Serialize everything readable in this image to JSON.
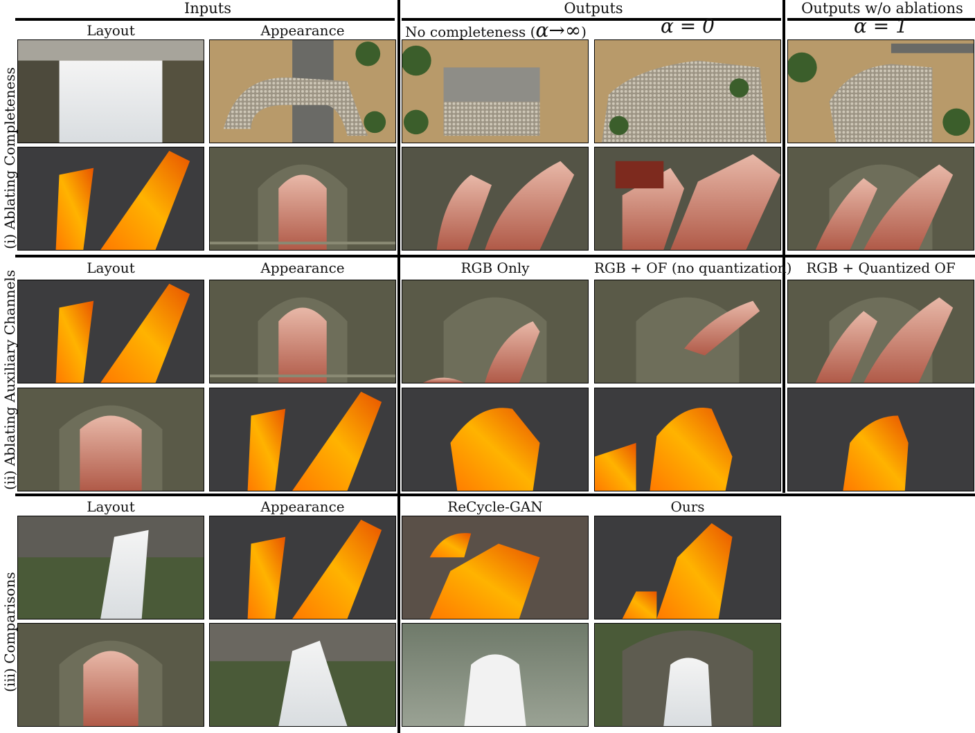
{
  "headers": {
    "inputs": "Inputs",
    "outputs": "Outputs",
    "outputs_wo": "Outputs w/o ablations"
  },
  "section1": {
    "row_label": "(i) Ablating Completeness",
    "cols": [
      "Layout",
      "Appearance",
      "No completeness (",
      "α→∞",
      ")",
      "α = 0",
      "α = 1"
    ]
  },
  "section2": {
    "row_label": "(ii) Ablating Auxiliary Channels",
    "cols": [
      "Layout",
      "Appearance",
      "RGB Only",
      "RGB + OF (no quantization)",
      "RGB + Quantized OF"
    ]
  },
  "section3": {
    "row_label": "(iii) Comparisons",
    "cols": [
      "Layout",
      "Appearance",
      "ReCycle-GAN",
      "Ours"
    ]
  },
  "images": {
    "waterfall": "waterfall",
    "sheep_road": "sheep herd on road",
    "lava": "lava flow",
    "pipe_sheep": "sheep exiting pipe",
    "blur": "blurry waterfall"
  }
}
